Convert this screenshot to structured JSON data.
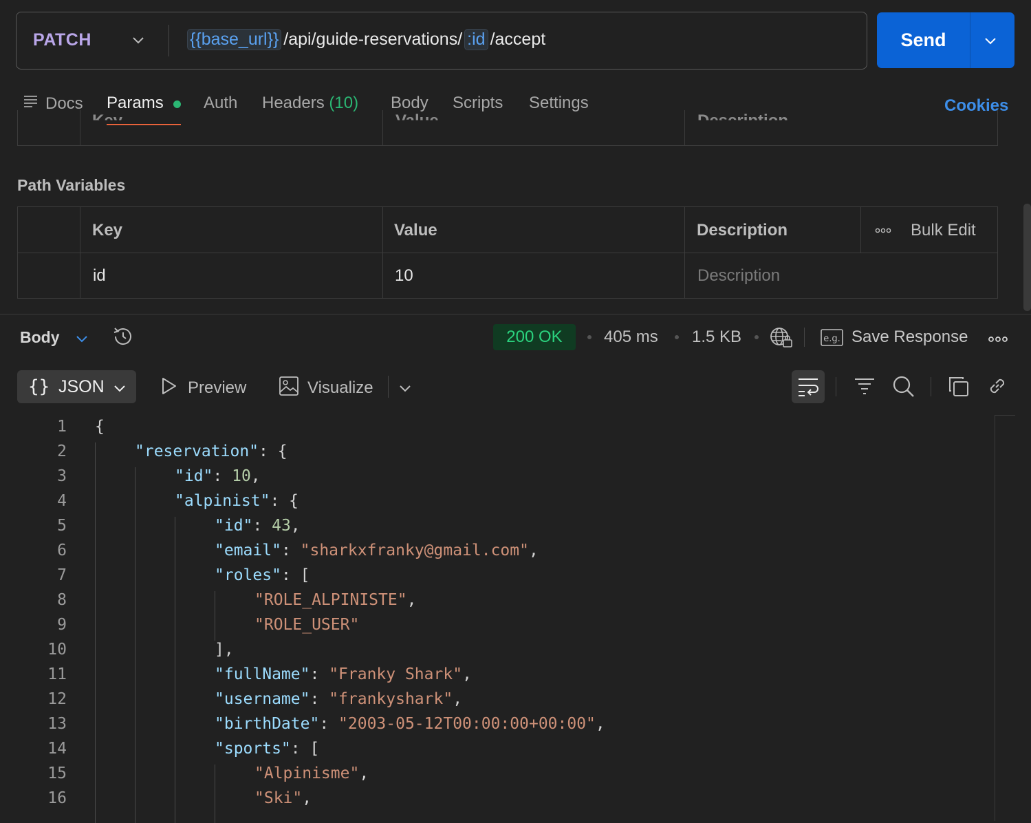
{
  "request": {
    "method": "PATCH",
    "url": {
      "base_var": "{{base_url}}",
      "path1": "/api/guide-reservations/",
      "id_var": ":id",
      "path2": "/accept"
    },
    "send_label": "Send"
  },
  "tabs": {
    "docs": "Docs",
    "params": "Params",
    "auth": "Auth",
    "headers": "Headers",
    "headers_count": "(10)",
    "body": "Body",
    "scripts": "Scripts",
    "settings": "Settings",
    "cookies": "Cookies"
  },
  "query_params_ghost": {
    "key": "Key",
    "value": "Value",
    "description": "Description"
  },
  "path_variables": {
    "title": "Path Variables",
    "headers": {
      "key": "Key",
      "value": "Value",
      "description": "Description",
      "bulk_edit": "Bulk Edit"
    },
    "rows": [
      {
        "key": "id",
        "value": "10",
        "description_placeholder": "Description"
      }
    ]
  },
  "response": {
    "body_label": "Body",
    "status": "200 OK",
    "time": "405 ms",
    "size": "1.5 KB",
    "save_response": "Save Response",
    "view": {
      "format": "JSON",
      "braces": "{}",
      "preview": "Preview",
      "visualize": "Visualize"
    },
    "lines": [
      {
        "n": "1",
        "indent": 0,
        "tokens": [
          [
            "p",
            "{"
          ]
        ]
      },
      {
        "n": "2",
        "indent": 1,
        "tokens": [
          [
            "k",
            "\"reservation\""
          ],
          [
            "p",
            ": {"
          ]
        ]
      },
      {
        "n": "3",
        "indent": 2,
        "tokens": [
          [
            "k",
            "\"id\""
          ],
          [
            "p",
            ": "
          ],
          [
            "n",
            "10"
          ],
          [
            "p",
            ","
          ]
        ]
      },
      {
        "n": "4",
        "indent": 2,
        "tokens": [
          [
            "k",
            "\"alpinist\""
          ],
          [
            "p",
            ": {"
          ]
        ]
      },
      {
        "n": "5",
        "indent": 3,
        "tokens": [
          [
            "k",
            "\"id\""
          ],
          [
            "p",
            ": "
          ],
          [
            "n",
            "43"
          ],
          [
            "p",
            ","
          ]
        ]
      },
      {
        "n": "6",
        "indent": 3,
        "tokens": [
          [
            "k",
            "\"email\""
          ],
          [
            "p",
            ": "
          ],
          [
            "s",
            "\"sharkxfranky@gmail.com\""
          ],
          [
            "p",
            ","
          ]
        ]
      },
      {
        "n": "7",
        "indent": 3,
        "tokens": [
          [
            "k",
            "\"roles\""
          ],
          [
            "p",
            ": ["
          ]
        ]
      },
      {
        "n": "8",
        "indent": 4,
        "tokens": [
          [
            "s",
            "\"ROLE_ALPINISTE\""
          ],
          [
            "p",
            ","
          ]
        ]
      },
      {
        "n": "9",
        "indent": 4,
        "tokens": [
          [
            "s",
            "\"ROLE_USER\""
          ]
        ]
      },
      {
        "n": "10",
        "indent": 3,
        "tokens": [
          [
            "p",
            "],"
          ]
        ]
      },
      {
        "n": "11",
        "indent": 3,
        "tokens": [
          [
            "k",
            "\"fullName\""
          ],
          [
            "p",
            ": "
          ],
          [
            "s",
            "\"Franky Shark\""
          ],
          [
            "p",
            ","
          ]
        ]
      },
      {
        "n": "12",
        "indent": 3,
        "tokens": [
          [
            "k",
            "\"username\""
          ],
          [
            "p",
            ": "
          ],
          [
            "s",
            "\"frankyshark\""
          ],
          [
            "p",
            ","
          ]
        ]
      },
      {
        "n": "13",
        "indent": 3,
        "tokens": [
          [
            "k",
            "\"birthDate\""
          ],
          [
            "p",
            ": "
          ],
          [
            "s",
            "\"2003-05-12T00:00:00+00:00\""
          ],
          [
            "p",
            ","
          ]
        ]
      },
      {
        "n": "14",
        "indent": 3,
        "tokens": [
          [
            "k",
            "\"sports\""
          ],
          [
            "p",
            ": ["
          ]
        ]
      },
      {
        "n": "15",
        "indent": 4,
        "tokens": [
          [
            "s",
            "\"Alpinisme\""
          ],
          [
            "p",
            ","
          ]
        ]
      },
      {
        "n": "16",
        "indent": 4,
        "tokens": [
          [
            "s",
            "\"Ski\""
          ],
          [
            "p",
            ","
          ]
        ]
      }
    ]
  },
  "colors": {
    "accent_send": "#0b63d6",
    "status_ok": "#2bd27e",
    "json_key": "#9cdcfe",
    "json_string": "#ce9178",
    "json_number": "#b5cea8",
    "params_underline": "#e8623a",
    "cookies_link": "#3d8ee9"
  },
  "icons": [
    "chevron-down-icon",
    "docs-lines-icon",
    "history-icon",
    "globe-lock-icon",
    "example-eg-icon",
    "more-dots-icon",
    "play-preview-icon",
    "image-visualize-icon",
    "wrap-lines-icon",
    "filter-icon",
    "search-icon",
    "copy-icon",
    "link-icon"
  ]
}
